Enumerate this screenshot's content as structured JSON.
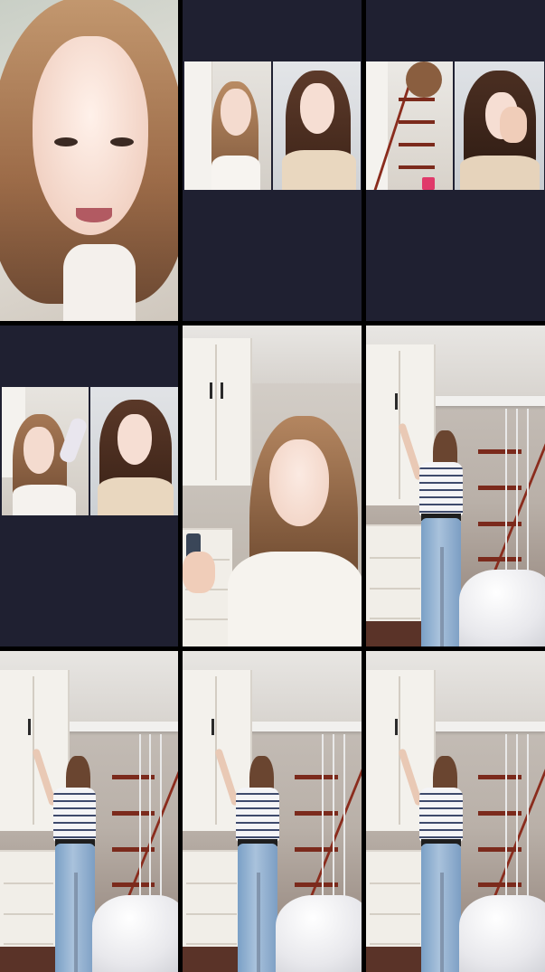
{
  "grid": {
    "columns": 3,
    "rows": 3,
    "tile_background": "#1f2031",
    "gap_color": "#000000"
  },
  "tiles": [
    {
      "id": "r1c1",
      "content": "selfie-closeup",
      "hair": "#a67855",
      "shirt": "#f4f0ec"
    },
    {
      "id": "r1c2",
      "content": "two-person-call"
    },
    {
      "id": "r1c3",
      "content": "two-person-call"
    },
    {
      "id": "r2c1",
      "content": "two-person-call"
    },
    {
      "id": "r2c2",
      "content": "person-with-phone",
      "hair": "#7a5438",
      "shirt": "#f6f3ee"
    },
    {
      "id": "r2c3",
      "content": "room-person-reaching"
    },
    {
      "id": "r3c1",
      "content": "room-person-reaching"
    },
    {
      "id": "r3c2",
      "content": "room-person-reaching"
    },
    {
      "id": "r3c3",
      "content": "room-person-reaching"
    }
  ]
}
